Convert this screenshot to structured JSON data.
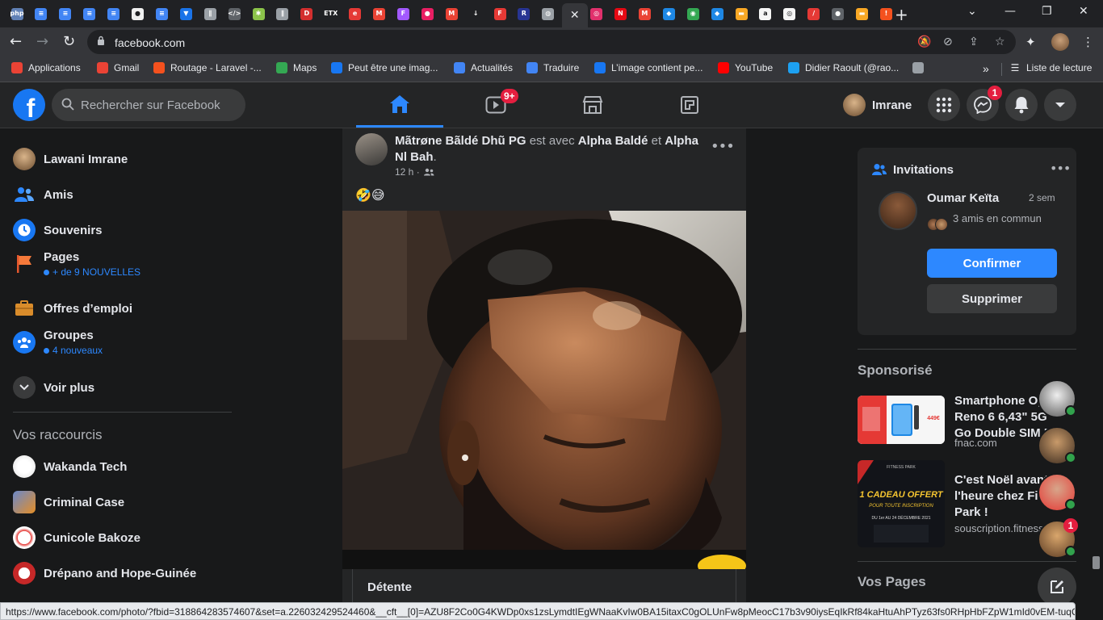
{
  "browser": {
    "tabs": [
      {
        "icon": "php-icon",
        "color": "#6181b6",
        "glyph": "php"
      },
      {
        "icon": "google-docs-icon",
        "color": "#4285f4",
        "glyph": "≡"
      },
      {
        "icon": "google-docs-icon",
        "color": "#4285f4",
        "glyph": "≡"
      },
      {
        "icon": "google-docs-icon",
        "color": "#4285f4",
        "glyph": "≡"
      },
      {
        "icon": "google-docs-icon",
        "color": "#4285f4",
        "glyph": "≡"
      },
      {
        "icon": "github-icon",
        "color": "#f0f0f0",
        "glyph": "●"
      },
      {
        "icon": "google-docs-icon",
        "color": "#4285f4",
        "glyph": "≡"
      },
      {
        "icon": "pocket-icon",
        "color": "#1a73e8",
        "glyph": "▼"
      },
      {
        "icon": "attachment-icon",
        "color": "#9aa0a6",
        "glyph": "∥"
      },
      {
        "icon": "code-icon",
        "color": "#5f6368",
        "glyph": "</>"
      },
      {
        "icon": "puzzle-icon",
        "color": "#8bc34a",
        "glyph": "✱"
      },
      {
        "icon": "attachment-icon",
        "color": "#9aa0a6",
        "glyph": "∥"
      },
      {
        "icon": "d-logo-icon",
        "color": "#d32f2f",
        "glyph": "D"
      },
      {
        "icon": "etx-icon",
        "color": "#202124",
        "glyph": "ETX"
      },
      {
        "icon": "e-logo-icon",
        "color": "#e53935",
        "glyph": "e"
      },
      {
        "icon": "gmail-icon",
        "color": "#ea4335",
        "glyph": "M"
      },
      {
        "icon": "figma-icon",
        "color": "#a259ff",
        "glyph": "F"
      },
      {
        "icon": "rec-icon",
        "color": "#e91e63",
        "glyph": "●"
      },
      {
        "icon": "gmail-icon",
        "color": "#ea4335",
        "glyph": "M"
      },
      {
        "icon": "download-icon",
        "color": "#202124",
        "glyph": "↓"
      },
      {
        "icon": "f-logo-icon",
        "color": "#e53935",
        "glyph": "F"
      },
      {
        "icon": "r-logo-icon",
        "color": "#283593",
        "glyph": "R"
      },
      {
        "icon": "globe-icon",
        "color": "#9aa0a6",
        "glyph": "◍"
      },
      {
        "icon": "close-icon",
        "active": true
      },
      {
        "icon": "instagram-icon",
        "color": "#e1306c",
        "glyph": "◎"
      },
      {
        "icon": "netflix-icon",
        "color": "#e50914",
        "glyph": "N"
      },
      {
        "icon": "gmail-icon",
        "color": "#ea4335",
        "glyph": "M"
      },
      {
        "icon": "bouygues-icon",
        "color": "#1e88e5",
        "glyph": "◆"
      },
      {
        "icon": "maps-icon",
        "color": "#34a853",
        "glyph": "◉"
      },
      {
        "icon": "bouygues-icon",
        "color": "#1e88e5",
        "glyph": "◆"
      },
      {
        "icon": "folder-icon",
        "color": "#f9a825",
        "glyph": "▬"
      },
      {
        "icon": "amazon-icon",
        "color": "#f5f5f5",
        "glyph": "a"
      },
      {
        "icon": "chrome-icon",
        "color": "#f5f5f5",
        "glyph": "◎"
      },
      {
        "icon": "pdf-icon",
        "color": "#e53935",
        "glyph": "/"
      },
      {
        "icon": "apple-icon",
        "color": "#5f6368",
        "glyph": "●"
      },
      {
        "icon": "folder-icon",
        "color": "#f9a825",
        "glyph": "▬"
      },
      {
        "icon": "warning-icon",
        "color": "#f4511e",
        "glyph": "!"
      }
    ],
    "url": "facebook.com",
    "bookmarks": [
      {
        "label": "Applications",
        "icon": "apps-grid-icon",
        "color": "#ea4335"
      },
      {
        "label": "Gmail",
        "icon": "gmail-icon",
        "color": "#ea4335"
      },
      {
        "label": "Routage - Laravel -...",
        "icon": "laravel-icon",
        "color": "#f4511e"
      },
      {
        "label": "Maps",
        "icon": "maps-icon",
        "color": "#34a853"
      },
      {
        "label": "Peut être une imag...",
        "icon": "facebook-icon",
        "color": "#1877f2"
      },
      {
        "label": "Actualités",
        "icon": "news-icon",
        "color": "#4285f4"
      },
      {
        "label": "Traduire",
        "icon": "translate-icon",
        "color": "#4285f4"
      },
      {
        "label": "L’image contient pe...",
        "icon": "facebook-icon",
        "color": "#1877f2"
      },
      {
        "label": "YouTube",
        "icon": "youtube-icon",
        "color": "#ff0000"
      },
      {
        "label": "Didier Raoult (@rao...",
        "icon": "twitter-icon",
        "color": "#1da1f2"
      },
      {
        "label": "",
        "icon": "globe-icon",
        "color": "#9aa0a6"
      }
    ],
    "more_bookmarks": "»",
    "reading_list": "Liste de lecture",
    "status_url": "https://www.facebook.com/photo/?fbid=318864283574607&set=a.226032429524460&__cft__[0]=AZU8F2Co0G4KWDp0xs1zsLymdtIEgWNaaKvIw0BA15itaxC0gOLUnFw8pMeocC17b3v90iysEqIkRf84kaHtuAhPTyz63fs0RHpHbFZpW1mId0vEM-tuqQ3lf..."
  },
  "fb": {
    "search_placeholder": "Rechercher sur Facebook",
    "user_name": "Imrane",
    "video_badge": "9+",
    "messenger_badge": "1",
    "left_nav": [
      {
        "label": "Lawani Imrane",
        "icon": "profile-avatar",
        "sub": ""
      },
      {
        "label": "Amis",
        "icon": "friends-icon",
        "sub": ""
      },
      {
        "label": "Souvenirs",
        "icon": "clock-icon",
        "sub": ""
      },
      {
        "label": "Pages",
        "icon": "flag-icon",
        "sub": "+ de 9 NOUVELLES"
      },
      {
        "label": "Offres d’emploi",
        "icon": "briefcase-icon",
        "sub": ""
      },
      {
        "label": "Groupes",
        "icon": "groups-icon",
        "sub": "4 nouveaux"
      },
      {
        "label": "Voir plus",
        "icon": "chevron-down-icon",
        "sub": ""
      }
    ],
    "shortcuts_title": "Vos raccourcis",
    "shortcuts": [
      {
        "label": "Wakanda Tech",
        "icon": "wakanda-tech-avatar"
      },
      {
        "label": "Criminal Case",
        "icon": "criminal-case-avatar"
      },
      {
        "label": "Cunicole Bakoze",
        "icon": "cunicole-avatar"
      },
      {
        "label": "Drépano and Hope-Guinée",
        "icon": "drepano-avatar"
      }
    ],
    "post": {
      "author": "Mãtrøne Bãldé Dhũ PG",
      "with_text": "est avec",
      "tag1": "Alpha Baldé",
      "and_text": "et",
      "tag2": "Alpha Nl Bah",
      "time": "12 h ·",
      "privacy_icon": "friends-audience-icon",
      "emoji": "🤣😅",
      "caption": "Détente"
    },
    "invitations": {
      "title": "Invitations",
      "name": "Oumar Keïta",
      "time": "2 sem",
      "mutual": "3 amis en commun",
      "confirm": "Confirmer",
      "delete": "Supprimer"
    },
    "sponsored_title": "Sponsorisé",
    "ads": [
      {
        "title_lines": [
          "Smartphone Op...",
          "Reno 6 6,43\" 5G",
          "Go Double SIM Noir"
        ],
        "domain": "fnac.com"
      },
      {
        "title_lines": [
          "C'est Noël avant",
          "l'heure chez Fit...",
          "Park !"
        ],
        "domain": "souscription.fitness..."
      }
    ],
    "ad1_price": "449€",
    "ad2_text1": "1 CADEAU OFFERT",
    "ad2_text2": "POUR TOUTE INSCRIPTION",
    "ad2_text3": "DU 1er AU 24 DÉCEMBRE 2021",
    "ad2_brand": "FITNESS PARK",
    "pages_title": "Vos Pages",
    "contact_badge": "1"
  }
}
